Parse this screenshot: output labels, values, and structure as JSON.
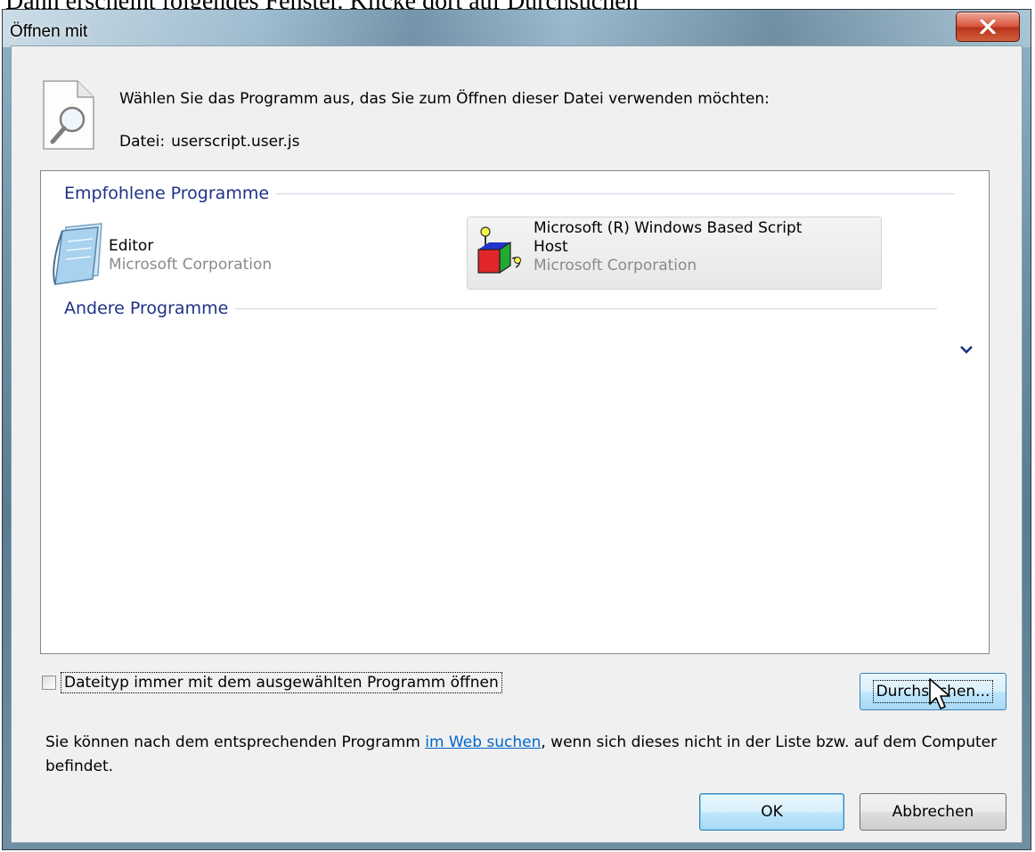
{
  "page_caption": "Dann erscheint folgendes Fenster. Klicke dort auf Durchsuchen",
  "window": {
    "title": "Öffnen mit",
    "close_label": "X"
  },
  "dialog": {
    "prompt": "Wählen Sie das Programm aus, das Sie zum Öffnen dieser Datei verwenden möchten:",
    "file_label": "Datei:",
    "file_name": "userscript.user.js"
  },
  "recommended": {
    "header": "Empfohlene Programme",
    "items": [
      {
        "name": "Editor",
        "company": "Microsoft Corporation",
        "icon": "notepad-icon",
        "selected": false
      },
      {
        "name_line1": "Microsoft (R) Windows Based Script",
        "name_line2": "Host",
        "company": "Microsoft Corporation",
        "icon": "script-host-icon",
        "selected": true
      }
    ]
  },
  "other": {
    "header": "Andere Programme",
    "expand_icon": "chevron-down-icon"
  },
  "checkbox": {
    "label": "Dateityp immer mit dem ausgewählten Programm öffnen",
    "checked": false
  },
  "browse_button": {
    "label": "Durchsuchen..."
  },
  "info": {
    "text_before": "Sie können nach dem entsprechenden Programm ",
    "link": "im Web suchen",
    "text_after": ", wenn sich dieses nicht in der Liste bzw. auf dem Computer befindet."
  },
  "buttons": {
    "ok": "OK",
    "cancel": "Abbrechen"
  },
  "colors": {
    "group_header": "#1e3287",
    "link": "#0066cc",
    "company_gray": "#8a8a8a"
  }
}
